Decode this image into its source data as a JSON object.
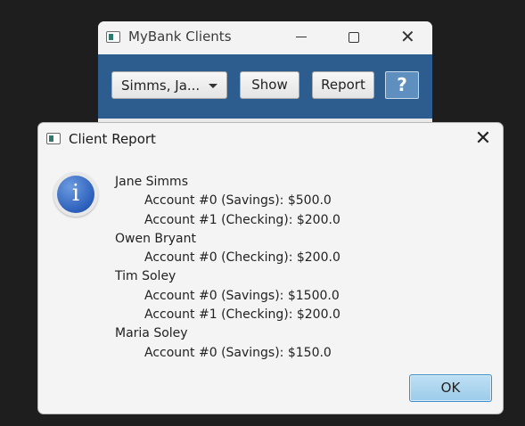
{
  "main_window": {
    "title": "MyBank Clients",
    "client_select_value": "Simms, Ja...",
    "show_label": "Show",
    "report_label": "Report",
    "help_label": "?"
  },
  "dialog": {
    "title": "Client Report",
    "ok_label": "OK",
    "lines": [
      {
        "text": "Jane Simms",
        "indent": false
      },
      {
        "text": "Account #0 (Savings): $500.0",
        "indent": true
      },
      {
        "text": "Account #1 (Checking): $200.0",
        "indent": true
      },
      {
        "text": "Owen Bryant",
        "indent": false
      },
      {
        "text": "Account #0 (Checking): $200.0",
        "indent": true
      },
      {
        "text": "Tim Soley",
        "indent": false
      },
      {
        "text": "Account #0 (Savings): $1500.0",
        "indent": true
      },
      {
        "text": "Account #1 (Checking): $200.0",
        "indent": true
      },
      {
        "text": "Maria Soley",
        "indent": false
      },
      {
        "text": "Account #0 (Savings): $150.0",
        "indent": true
      }
    ]
  },
  "icons": {
    "app": "app-window-icon",
    "info": "information-icon",
    "close": "close-icon",
    "minimize": "minimize-icon",
    "maximize": "maximize-icon",
    "dropdown": "chevron-down-icon"
  },
  "colors": {
    "toolbar_bg": "#2d5d8f",
    "help_button_bg": "#5f8fbf",
    "dialog_bg": "#f4f4f4",
    "ok_button_bg": "#9ccbe9",
    "desktop_bg": "#1e1e1e"
  }
}
